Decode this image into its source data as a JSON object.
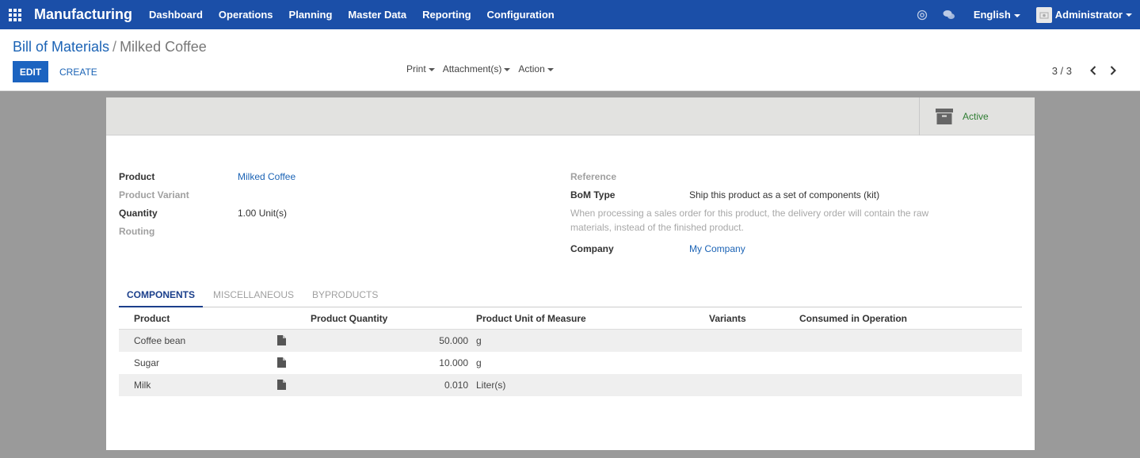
{
  "navbar": {
    "app_name": "Manufacturing",
    "menu": [
      "Dashboard",
      "Operations",
      "Planning",
      "Master Data",
      "Reporting",
      "Configuration"
    ],
    "language": "English",
    "user": "Administrator",
    "bg_color": "#1b4fa8"
  },
  "control_panel": {
    "breadcrumb_parent": "Bill of Materials",
    "breadcrumb_separator": "/",
    "breadcrumb_current": "Milked Coffee",
    "edit_label": "EDIT",
    "create_label": "CREATE",
    "print_label": "Print",
    "attachments_label": "Attachment(s)",
    "action_label": "Action",
    "pager_value": "3 / 3"
  },
  "sheet": {
    "active_label": "Active",
    "left_fields": {
      "product_label": "Product",
      "product_value": "Milked Coffee",
      "variant_label": "Product Variant",
      "quantity_label": "Quantity",
      "quantity_value": "1.00",
      "quantity_uom": "Unit(s)",
      "routing_label": "Routing"
    },
    "right_fields": {
      "reference_label": "Reference",
      "bom_type_label": "BoM Type",
      "bom_type_value": "Ship this product as a set of components (kit)",
      "bom_type_help_1": "When processing a sales order for this product, the delivery order will contain the raw",
      "bom_type_help_2": "materials, instead of the finished product.",
      "company_label": "Company",
      "company_value": "My Company"
    }
  },
  "tabs": [
    "COMPONENTS",
    "MISCELLANEOUS",
    "BYPRODUCTS"
  ],
  "active_tab": "COMPONENTS",
  "table": {
    "headers": [
      "Product",
      "Product Quantity",
      "Product Unit of Measure",
      "Variants",
      "Consumed in Operation"
    ],
    "rows": [
      {
        "product": "Coffee bean",
        "quantity": "50.000",
        "uom": "g"
      },
      {
        "product": "Sugar",
        "quantity": "10.000",
        "uom": "g"
      },
      {
        "product": "Milk",
        "quantity": "0.010",
        "uom": "Liter(s)"
      }
    ]
  }
}
